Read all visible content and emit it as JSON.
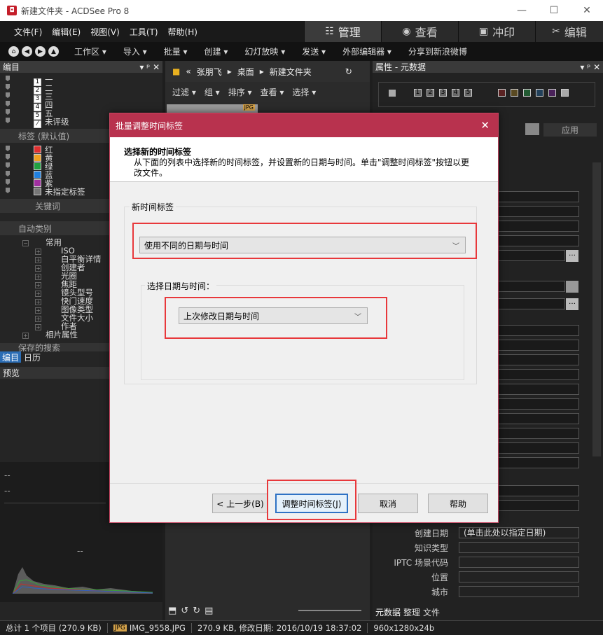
{
  "window": {
    "title": "新建文件夹 - ACDSee Pro 8",
    "minimize": "—",
    "maximize": "☐",
    "close": "✕"
  },
  "menu": [
    "文件(F)",
    "编辑(E)",
    "视图(V)",
    "工具(T)",
    "帮助(H)"
  ],
  "modes": [
    {
      "label": "管理",
      "icon": "☷"
    },
    {
      "label": "查看",
      "icon": "◉"
    },
    {
      "label": "冲印",
      "icon": "▣"
    },
    {
      "label": "编辑",
      "icon": "✂"
    }
  ],
  "toolbar": [
    "工作区 ▾",
    "导入 ▾",
    "批量 ▾",
    "创建 ▾",
    "幻灯放映 ▾",
    "发送 ▾",
    "外部编辑器 ▾",
    "分享到新浪微博"
  ],
  "left": {
    "header": "编目",
    "ratings": [
      {
        "n": "1",
        "label": "一"
      },
      {
        "n": "2",
        "label": "二"
      },
      {
        "n": "3",
        "label": "三"
      },
      {
        "n": "4",
        "label": "四"
      },
      {
        "n": "5",
        "label": "五"
      },
      {
        "n": "",
        "label": "未评级"
      }
    ],
    "labels_header": "标签 (默认值)",
    "labels": [
      {
        "label": "红",
        "color": "#e03030"
      },
      {
        "label": "黄",
        "color": "#f0a020"
      },
      {
        "label": "绿",
        "color": "#20a040"
      },
      {
        "label": "蓝",
        "color": "#2080e0"
      },
      {
        "label": "紫",
        "color": "#a030a0"
      },
      {
        "label": "未指定标签",
        "color": "#777777"
      }
    ],
    "keywords": "关键词",
    "autocat_header": "自动类别",
    "common": "常用",
    "autocat": [
      "ISO",
      "白平衡详情",
      "创建者",
      "光圈",
      "焦距",
      "镜头型号",
      "快门速度",
      "图像类型",
      "文件大小",
      "作者"
    ],
    "photo_props": "相片属性",
    "saved_search": "保存的搜索",
    "tabs": [
      "编目",
      "日历"
    ],
    "preview": "预览",
    "dash": "--"
  },
  "center": {
    "breadcrumb": [
      "«",
      "张朋飞",
      "桌面",
      "新建文件夹"
    ],
    "filters": [
      "过滤 ▾",
      "组 ▾",
      "排序 ▾",
      "查看 ▾",
      "选择 ▾"
    ],
    "badge": "JPG"
  },
  "right": {
    "header": "属性 - 元数据",
    "apply": "应用",
    "rating_nums": [
      "1",
      "2",
      "3",
      "4",
      "5"
    ],
    "fields": [
      {
        "label": "创建日期",
        "value": "(单击此处以指定日期)"
      },
      {
        "label": "知识类型",
        "value": ""
      },
      {
        "label": "IPTC 场景代码",
        "value": ""
      },
      {
        "label": "位置",
        "value": ""
      },
      {
        "label": "城市",
        "value": ""
      }
    ],
    "tabs": [
      "元数据",
      "整理",
      "文件"
    ]
  },
  "status": {
    "total": "总计 1 个项目 (270.9 KB)",
    "badge": "JPG",
    "file": "IMG_9558.JPG",
    "info": "270.9 KB, 修改日期: 2016/10/19 18:37:02",
    "dims": "960x1280x24b"
  },
  "dialog": {
    "title": "批量调整时间标签",
    "heading": "选择新的时间标签",
    "description": "从下面的列表中选择新的时间标签，并设置新的日期与时间。单击\"调整时间标签\"按钮以更改文件。",
    "group1": "新时间标签",
    "select1": "使用不同的日期与时间",
    "group2": "选择日期与时间：",
    "select2": "上次修改日期与时间",
    "buttons": {
      "back": "< 上一步(B)",
      "adjust": "调整时间标签(J)",
      "cancel": "取消",
      "help": "帮助"
    },
    "accent": "#b8324e",
    "highlight": "#e8383b"
  }
}
